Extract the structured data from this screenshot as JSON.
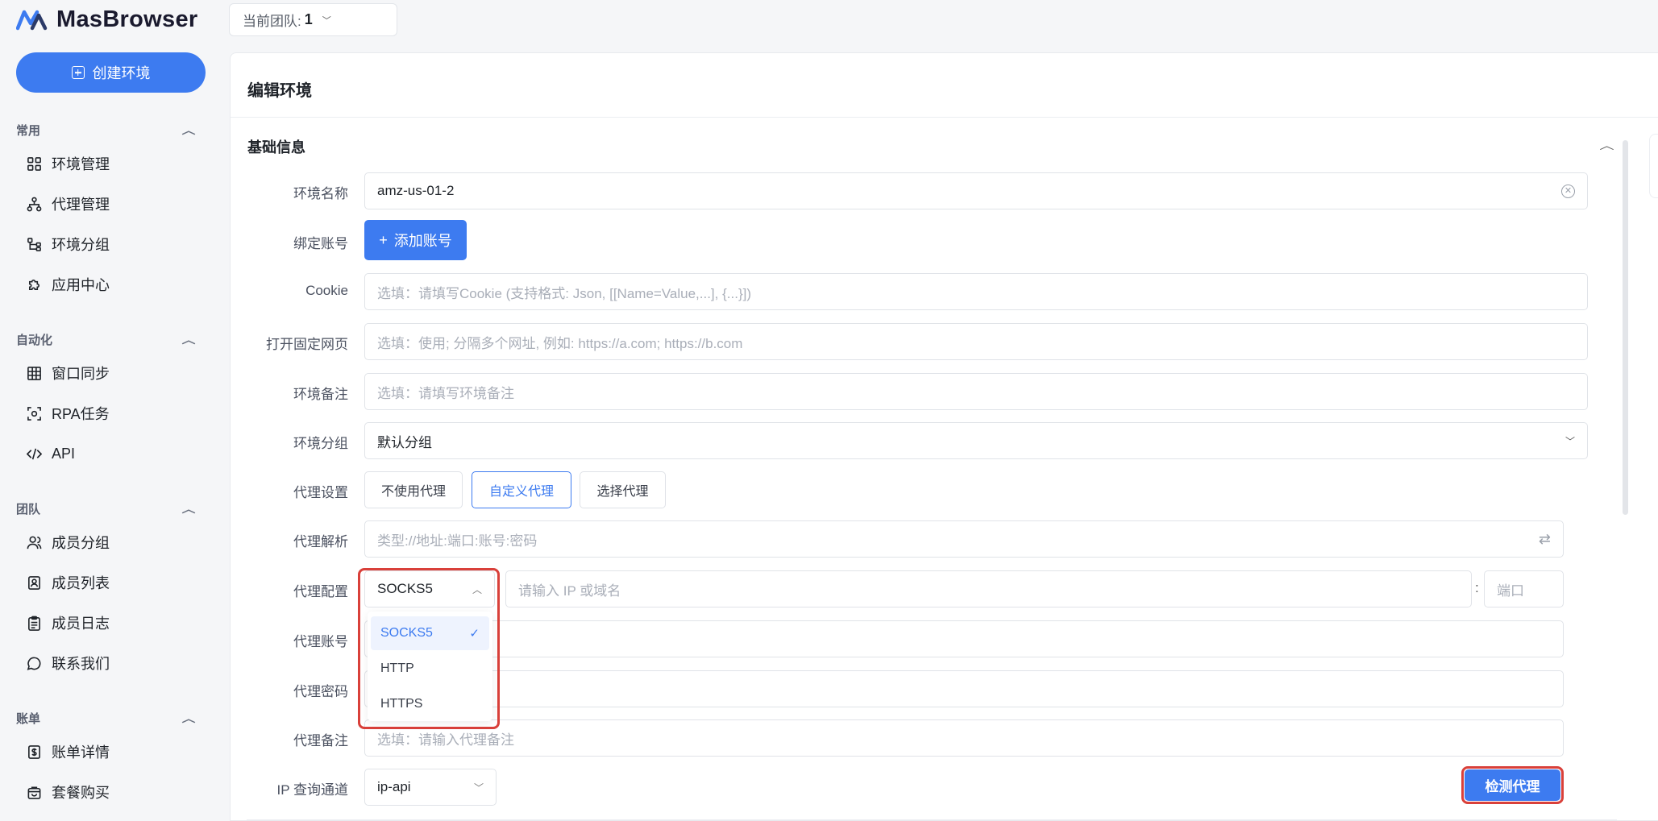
{
  "app": {
    "brand": "MasBrowser",
    "create_label": "创建环境",
    "team_label": "当前团队:",
    "team_value": "1"
  },
  "sidebar": {
    "sections": [
      {
        "title": "常用",
        "items": [
          {
            "label": "环境管理",
            "icon": "grid-icon"
          },
          {
            "label": "代理管理",
            "icon": "network-icon"
          },
          {
            "label": "环境分组",
            "icon": "branch-icon"
          },
          {
            "label": "应用中心",
            "icon": "puzzle-icon"
          }
        ]
      },
      {
        "title": "自动化",
        "items": [
          {
            "label": "窗口同步",
            "icon": "table-icon"
          },
          {
            "label": "RPA任务",
            "icon": "scan-icon"
          },
          {
            "label": "API",
            "icon": "code-icon"
          }
        ]
      },
      {
        "title": "团队",
        "items": [
          {
            "label": "成员分组",
            "icon": "users-icon"
          },
          {
            "label": "成员列表",
            "icon": "contact-icon"
          },
          {
            "label": "成员日志",
            "icon": "clipboard-icon"
          },
          {
            "label": "联系我们",
            "icon": "chat-icon"
          }
        ]
      },
      {
        "title": "账单",
        "items": [
          {
            "label": "账单详情",
            "icon": "bill-icon"
          },
          {
            "label": "套餐购买",
            "icon": "bag-icon"
          }
        ]
      }
    ]
  },
  "main": {
    "title": "编辑环境",
    "section": "基础信息",
    "form": {
      "env_name_label": "环境名称",
      "env_name_value": "amz-us-01-2",
      "bind_label": "绑定账号",
      "add_account": "添加账号",
      "cookie_label": "Cookie",
      "cookie_placeholder": "选填：请填写Cookie (支持格式: Json, [[Name=Value,...], {...}])",
      "open_url_label": "打开固定网页",
      "open_url_placeholder": "选填：使用; 分隔多个网址, 例如: https://a.com; https://b.com",
      "note_label": "环境备注",
      "note_placeholder": "选填：请填写环境备注",
      "group_label": "环境分组",
      "group_value": "默认分组",
      "proxy_setting_label": "代理设置",
      "proxy_options": [
        "不使用代理",
        "自定义代理",
        "选择代理"
      ],
      "proxy_parse_label": "代理解析",
      "proxy_parse_placeholder": "类型://地址:端口:账号:密码",
      "proxy_config_label": "代理配置",
      "proxy_type_value": "SOCKS5",
      "host_placeholder": "请输入 IP 或域名",
      "colon": ":",
      "port_placeholder": "端口",
      "proxy_account_label": "代理账号",
      "proxy_password_label": "代理密码",
      "proxy_note_label": "代理备注",
      "proxy_note_placeholder": "选填：请输入代理备注",
      "ip_channel_label": "IP 查询通道",
      "ip_channel_value": "ip-api",
      "detect_label": "检测代理"
    },
    "dropdown_options": [
      "SOCKS5",
      "HTTP",
      "HTTPS"
    ]
  },
  "colors": {
    "accent": "#3d7bf0",
    "highlight_border": "#d9403a"
  }
}
